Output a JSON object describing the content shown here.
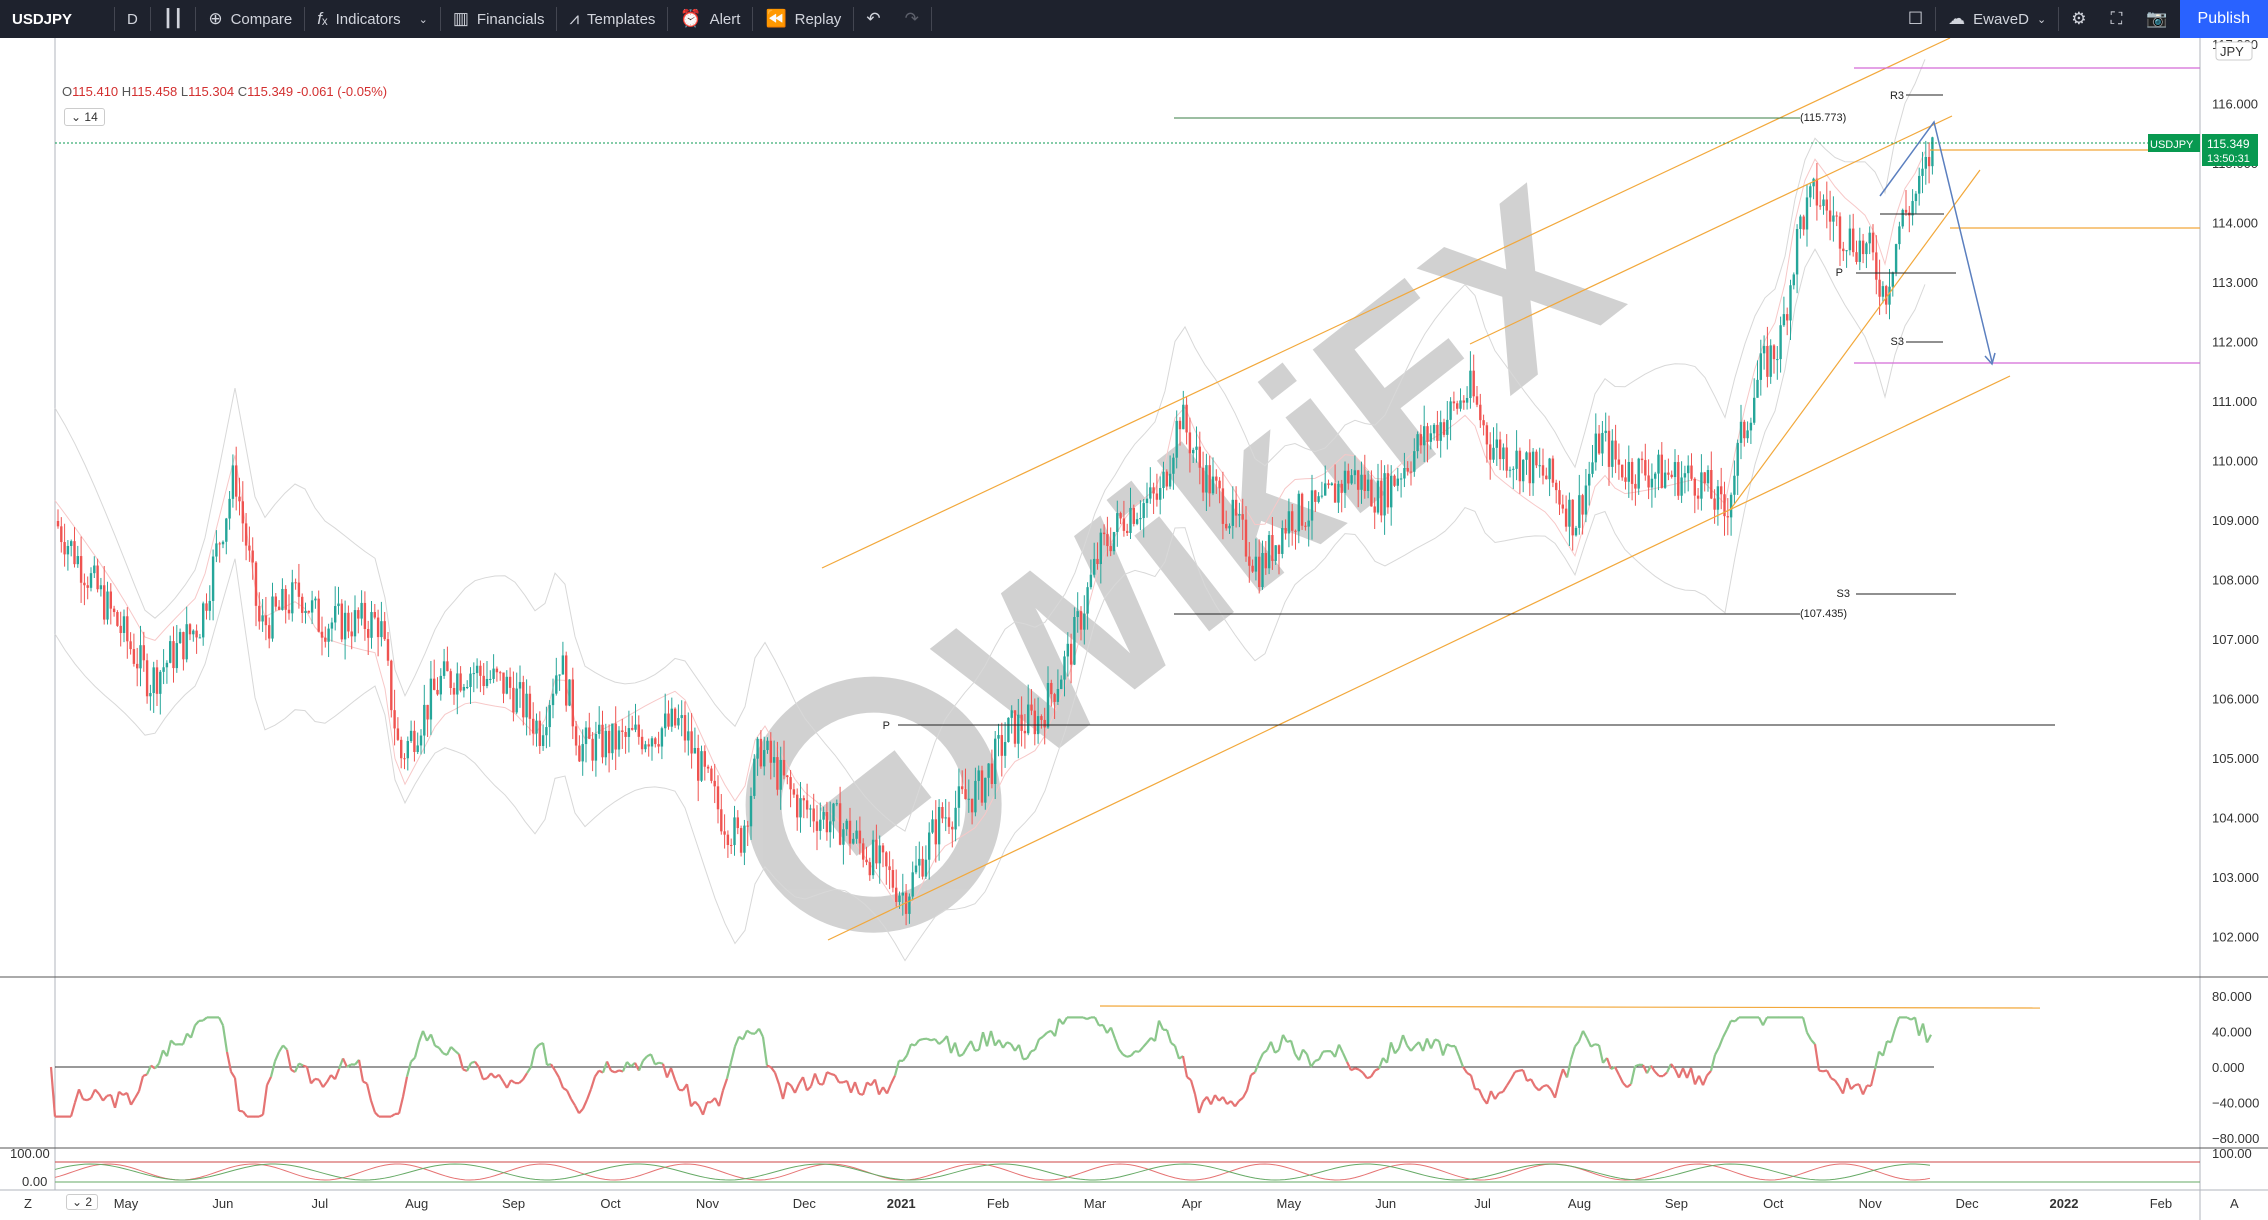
{
  "toolbar": {
    "symbol": "USDJPY",
    "interval": "D",
    "compare": "Compare",
    "indicators": "Indicators",
    "financials": "Financials",
    "templates": "Templates",
    "alert": "Alert",
    "replay": "Replay",
    "user": "EwaveD",
    "publish": "Publish"
  },
  "legend": {
    "o_key": "O",
    "open": "115.410",
    "h_key": "H",
    "high": "115.458",
    "l_key": "L",
    "low": "115.304",
    "c_key": "C",
    "close": "115.349",
    "change": "-0.061 (-0.05%)",
    "indicator_param": "14",
    "indicator2_param": "2"
  },
  "price_axis": {
    "currency": "JPY",
    "ticks": [
      "117.000",
      "116.000",
      "115.000",
      "114.000",
      "113.000",
      "112.000",
      "111.000",
      "110.000",
      "109.000",
      "108.000",
      "107.000",
      "106.000",
      "105.000",
      "104.000",
      "103.000",
      "102.000"
    ],
    "current_symbol": "USDJPY",
    "current_price": "115.349",
    "countdown": "13:50:31"
  },
  "osc_axis": {
    "ticks": [
      "80.000",
      "40.000",
      "0.000",
      "−40.000",
      "−80.000"
    ]
  },
  "osc2_axis": {
    "ticks": [
      "100.00",
      "0.00"
    ],
    "right_tick": "100.00"
  },
  "time_axis": {
    "labels": [
      "May",
      "Jun",
      "Jul",
      "Aug",
      "Sep",
      "Oct",
      "Nov",
      "Dec",
      "2021",
      "Feb",
      "Mar",
      "Apr",
      "May",
      "Jun",
      "Jul",
      "Aug",
      "Sep",
      "Oct",
      "Nov",
      "Dec",
      "2022",
      "Feb"
    ]
  },
  "annotations": {
    "level_high": "(115.773)",
    "level_low": "(107.435)",
    "r3": "R3",
    "p_right": "P",
    "s3_upper": "S3",
    "s3_lower": "S3",
    "p_left": "P"
  },
  "watermark": "WikiFX",
  "colors": {
    "bull": "#26a69a",
    "bear": "#ef5350",
    "channel": "#f2a83b",
    "pivot": "#d36ad6",
    "arrow": "#5b7fbf",
    "price_tag": "#089950"
  }
}
